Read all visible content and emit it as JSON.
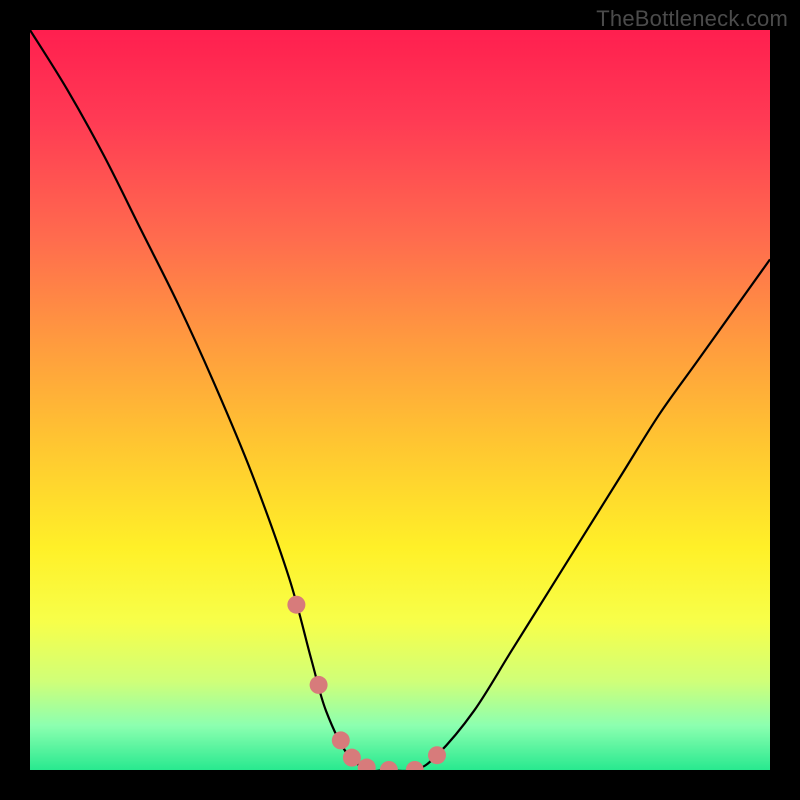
{
  "watermark": "TheBottleneck.com",
  "chart_data": {
    "type": "line",
    "title": "",
    "xlabel": "",
    "ylabel": "",
    "xlim": [
      0,
      100
    ],
    "ylim": [
      0,
      100
    ],
    "x": [
      0,
      5,
      10,
      15,
      20,
      25,
      30,
      35,
      38,
      40,
      43,
      46,
      48,
      52,
      55,
      60,
      65,
      70,
      75,
      80,
      85,
      90,
      95,
      100
    ],
    "values": [
      100,
      92,
      83,
      73,
      63,
      52,
      40,
      26,
      15,
      8,
      2,
      0,
      0,
      0,
      2,
      8,
      16,
      24,
      32,
      40,
      48,
      55,
      62,
      69
    ],
    "annotations": [
      {
        "type": "marker-dots",
        "color": "#d77b7b",
        "x_range": [
          36,
          55
        ]
      }
    ],
    "background_gradient": {
      "stops": [
        {
          "offset": 0.0,
          "color": "#ff1f4f"
        },
        {
          "offset": 0.12,
          "color": "#ff3a54"
        },
        {
          "offset": 0.28,
          "color": "#ff6b4e"
        },
        {
          "offset": 0.42,
          "color": "#ff9a3f"
        },
        {
          "offset": 0.56,
          "color": "#ffc631"
        },
        {
          "offset": 0.7,
          "color": "#fff028"
        },
        {
          "offset": 0.8,
          "color": "#f7ff4a"
        },
        {
          "offset": 0.88,
          "color": "#d0ff78"
        },
        {
          "offset": 0.94,
          "color": "#8cffb0"
        },
        {
          "offset": 1.0,
          "color": "#28e98f"
        }
      ]
    }
  }
}
